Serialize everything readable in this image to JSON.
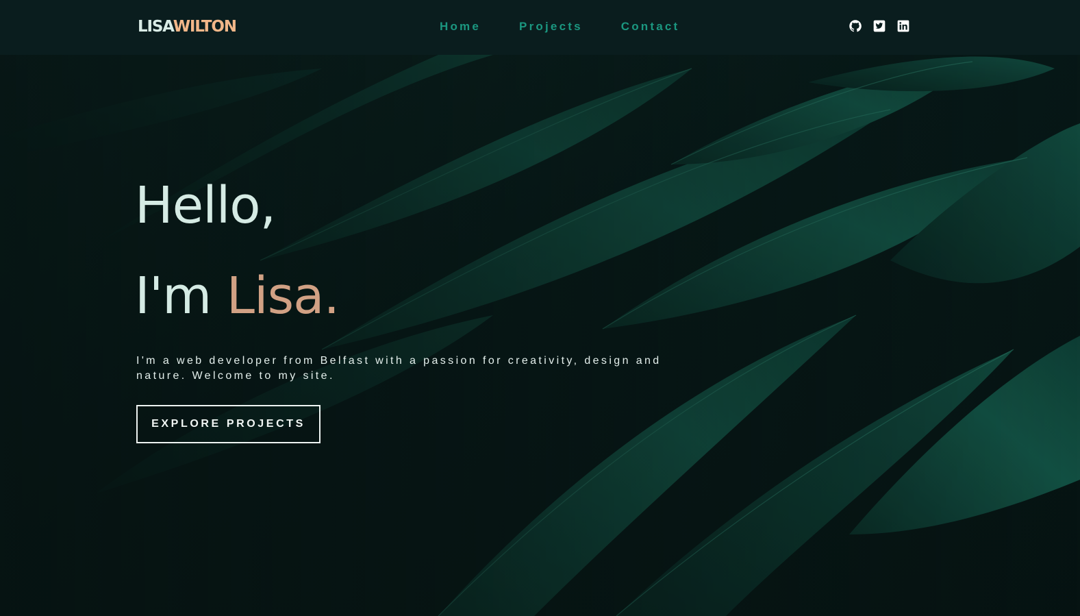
{
  "brand": {
    "first": "LISA",
    "last": "WILTON"
  },
  "nav": {
    "items": [
      {
        "label": "Home"
      },
      {
        "label": "Projects"
      },
      {
        "label": "Contact"
      }
    ]
  },
  "social": {
    "icons": [
      "github-icon",
      "twitter-icon",
      "linkedin-icon"
    ]
  },
  "hero": {
    "greeting": "Hello,",
    "intro_prefix": "I'm ",
    "name": "Lisa.",
    "tagline": "I'm a web developer from Belfast with a passion for creativity, design and nature. Welcome to my site.",
    "cta_label": "EXPLORE PROJECTS"
  },
  "colors": {
    "background": "#071516",
    "navbar": "#0a1d1e",
    "nav_link": "#1b9780",
    "brand_accent": "#f2b789",
    "name_accent": "#d1a184",
    "heading": "#d5ebe4",
    "feather": "#0f4a3d"
  }
}
